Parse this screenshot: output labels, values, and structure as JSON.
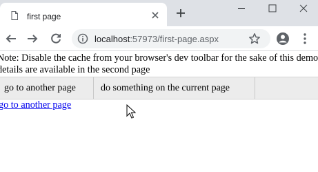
{
  "browser": {
    "tab": {
      "title": "first page"
    },
    "address": {
      "host": "localhost",
      "path": ":57973/first-page.aspx"
    }
  },
  "page": {
    "note": "Note: Disable the cache from your browser's dev toolbar for the sake of this demo, details are available in the second page",
    "tabs": [
      {
        "label": "go to another page"
      },
      {
        "label": "do something on the current page"
      }
    ],
    "link": "go to another page"
  },
  "icons": {
    "tab": "document-icon",
    "tab_close": "close-icon",
    "new_tab": "plus-icon",
    "minimize": "minimize-icon",
    "maximize": "maximize-icon",
    "close": "close-window-icon",
    "back": "back-arrow-icon",
    "forward": "forward-arrow-icon",
    "reload": "reload-icon",
    "site_info": "info-icon",
    "bookmark": "star-icon",
    "profile": "profile-icon",
    "menu": "more-vertical-icon"
  }
}
